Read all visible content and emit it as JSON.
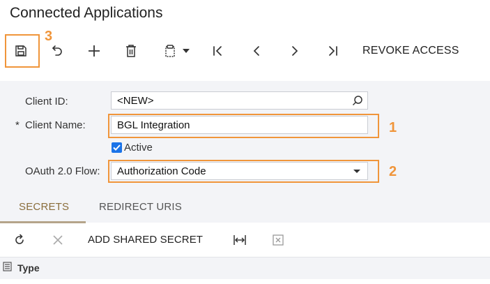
{
  "page": {
    "title": "Connected Applications"
  },
  "toolbar": {
    "revoke_label": "REVOKE ACCESS"
  },
  "form": {
    "client_id_label": "Client ID:",
    "client_id_value": "<NEW>",
    "required_marker": "*",
    "client_name_label": "Client Name:",
    "client_name_value": "BGL Integration",
    "active_label": "Active",
    "active_checked": true,
    "oauth_label": "OAuth 2.0 Flow:",
    "oauth_value": "Authorization Code"
  },
  "tabs": [
    {
      "label": "SECRETS",
      "active": true
    },
    {
      "label": "REDIRECT URIS",
      "active": false
    }
  ],
  "grid": {
    "add_secret_label": "ADD SHARED SECRET",
    "columns": [
      "Type"
    ]
  },
  "annotations": [
    "3",
    "1",
    "2"
  ],
  "colors": {
    "accent_highlight": "#f0953a",
    "checkbox": "#1a73e8",
    "active_tab": "#8a6d3b"
  }
}
